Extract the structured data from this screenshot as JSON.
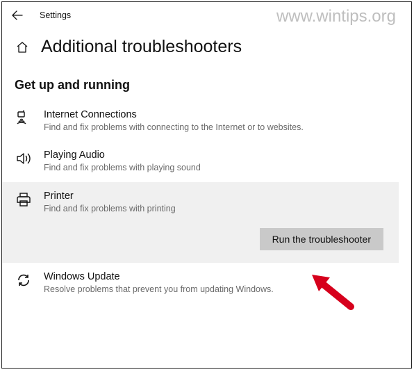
{
  "header": {
    "app_title": "Settings"
  },
  "watermark": "www.wintips.org",
  "page": {
    "title": "Additional troubleshooters",
    "section_heading": "Get up and running"
  },
  "items": [
    {
      "title": "Internet Connections",
      "desc": "Find and fix problems with connecting to the Internet or to websites."
    },
    {
      "title": "Playing Audio",
      "desc": "Find and fix problems with playing sound"
    },
    {
      "title": "Printer",
      "desc": "Find and fix problems with printing"
    },
    {
      "title": "Windows Update",
      "desc": "Resolve problems that prevent you from updating Windows."
    }
  ],
  "actions": {
    "run_label": "Run the troubleshooter"
  }
}
